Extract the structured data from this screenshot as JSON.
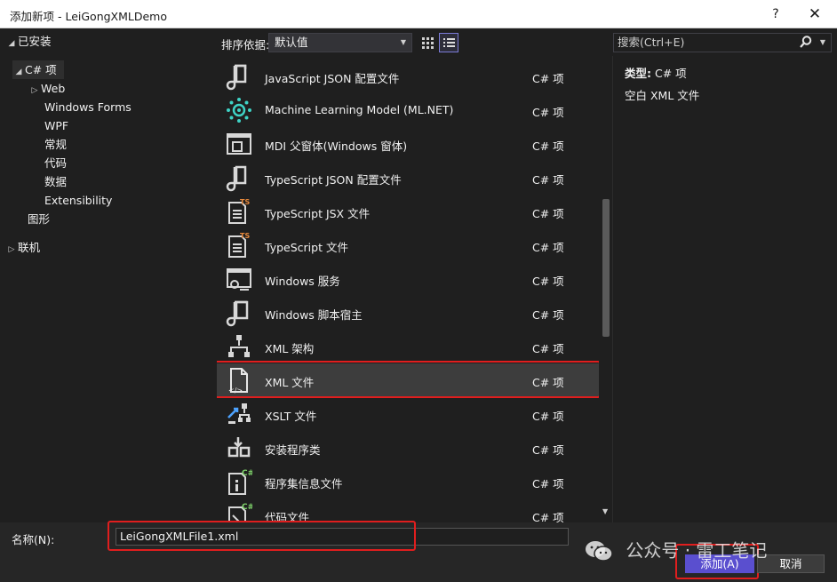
{
  "window": {
    "title": "添加新项 - LeiGongXMLDemo",
    "help_label": "?",
    "close_label": "✕"
  },
  "sidebar": {
    "installed": "已安装",
    "csharp": "C# 项",
    "web": "Web",
    "winforms": "Windows Forms",
    "wpf": "WPF",
    "general": "常规",
    "code": "代码",
    "data": "数据",
    "extensibility": "Extensibility",
    "graphics": "图形",
    "online": "联机"
  },
  "toolbar": {
    "sort_label": "排序依据:",
    "sort_value": "默认值"
  },
  "search": {
    "placeholder": "搜索(Ctrl+E)"
  },
  "templates": [
    {
      "name": "JavaScript JSON 配置文件",
      "category": "C# 项",
      "icon": "json-config-icon"
    },
    {
      "name": "Machine Learning Model (ML.NET)",
      "category": "C# 项",
      "icon": "ml-model-icon"
    },
    {
      "name": "MDI 父窗体(Windows 窗体)",
      "category": "C# 项",
      "icon": "mdi-form-icon"
    },
    {
      "name": "TypeScript JSON 配置文件",
      "category": "C# 项",
      "icon": "json-config-icon"
    },
    {
      "name": "TypeScript JSX 文件",
      "category": "C# 项",
      "icon": "typescript-file-icon"
    },
    {
      "name": "TypeScript 文件",
      "category": "C# 项",
      "icon": "typescript-file-icon"
    },
    {
      "name": "Windows 服务",
      "category": "C# 项",
      "icon": "windows-service-icon"
    },
    {
      "name": "Windows 脚本宿主",
      "category": "C# 项",
      "icon": "script-host-icon"
    },
    {
      "name": "XML 架构",
      "category": "C# 项",
      "icon": "xml-schema-icon"
    },
    {
      "name": "XML 文件",
      "category": "C# 项",
      "icon": "xml-file-icon"
    },
    {
      "name": "XSLT 文件",
      "category": "C# 项",
      "icon": "xslt-file-icon"
    },
    {
      "name": "安装程序类",
      "category": "C# 项",
      "icon": "installer-class-icon"
    },
    {
      "name": "程序集信息文件",
      "category": "C# 项",
      "icon": "assembly-info-icon"
    },
    {
      "name": "代码文件",
      "category": "C# 项",
      "icon": "code-file-icon"
    }
  ],
  "details": {
    "type_label": "类型:",
    "type_value": "C# 项",
    "description": "空白 XML 文件"
  },
  "bottom": {
    "name_label": "名称(N):",
    "name_value": "LeiGongXMLFile1.xml",
    "add_label": "添加(A)",
    "cancel_label": "取消"
  },
  "watermark": {
    "text": "公众号 · 雷工笔记"
  },
  "colors": {
    "accent": "#5a4fcf",
    "highlight_red": "#e01e1e",
    "icon_teal": "#3fd3c6",
    "icon_orange": "#e8893c",
    "icon_green": "#7fd36b"
  }
}
